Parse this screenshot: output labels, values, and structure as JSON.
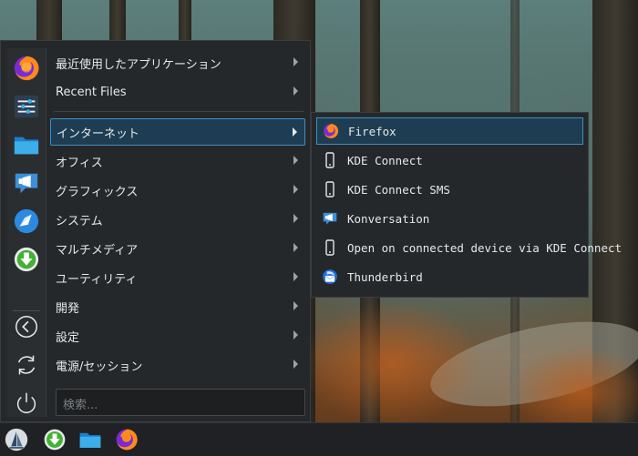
{
  "menu": {
    "items": [
      {
        "label": "最近使用したアプリケーション"
      },
      {
        "label": "Recent Files"
      },
      {
        "label": "インターネット"
      },
      {
        "label": "オフィス"
      },
      {
        "label": "グラフィックス"
      },
      {
        "label": "システム"
      },
      {
        "label": "マルチメディア"
      },
      {
        "label": "ユーティリティ"
      },
      {
        "label": "開発"
      },
      {
        "label": "設定"
      },
      {
        "label": "電源/セッション"
      }
    ],
    "selected_index": 2,
    "search_placeholder": "検索..."
  },
  "favorites": [
    {
      "icon": "firefox-icon"
    },
    {
      "icon": "system-settings-icon"
    },
    {
      "icon": "folder-icon"
    },
    {
      "icon": "konversation-icon"
    },
    {
      "icon": "kde-discover-icon"
    },
    {
      "icon": "download-icon"
    },
    {
      "icon": "back-icon"
    },
    {
      "icon": "refresh-icon"
    },
    {
      "icon": "power-icon"
    }
  ],
  "submenu": {
    "items": [
      {
        "label": "Firefox",
        "icon": "firefox-icon"
      },
      {
        "label": "KDE Connect",
        "icon": "phone-icon"
      },
      {
        "label": "KDE Connect SMS",
        "icon": "phone-icon"
      },
      {
        "label": "Konversation",
        "icon": "konversation-icon"
      },
      {
        "label": "Open on connected device via KDE Connect",
        "icon": "phone-icon"
      },
      {
        "label": "Thunderbird",
        "icon": "thunderbird-icon"
      }
    ],
    "selected_index": 0
  },
  "taskbar": {
    "items": [
      {
        "icon": "application-launcher-icon"
      },
      {
        "icon": "download-icon"
      },
      {
        "icon": "folder-icon"
      },
      {
        "icon": "firefox-icon"
      }
    ]
  },
  "colors": {
    "accent": "#3d8fc0",
    "selection_bg": "#1e3d52",
    "menu_bg": "#25282b",
    "taskbar_bg": "#1f2124"
  }
}
